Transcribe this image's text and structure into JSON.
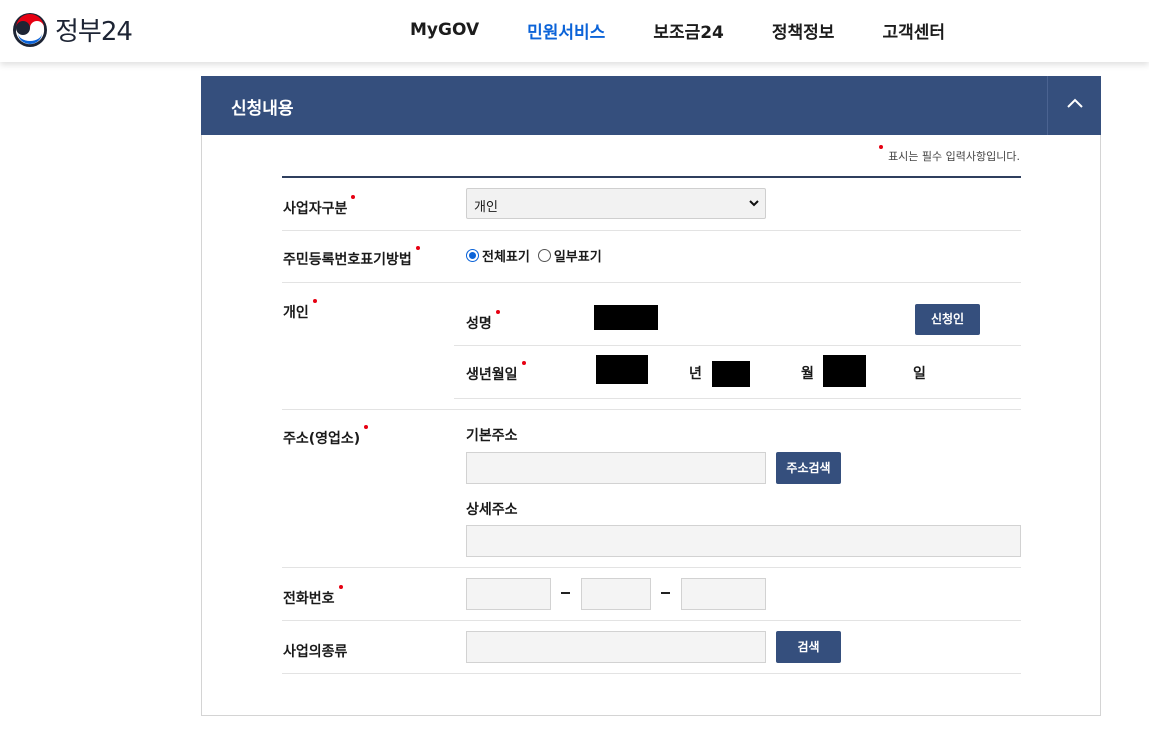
{
  "header": {
    "logo_text": "정부24",
    "nav": [
      "MyGOV",
      "민원서비스",
      "보조금24",
      "정책정보",
      "고객센터"
    ],
    "active_nav": "민원서비스"
  },
  "panel": {
    "title": "신청내용",
    "required_note": "표시는 필수 입력사항입니다."
  },
  "form": {
    "business_type": {
      "label": "사업자구분",
      "value": "개인"
    },
    "rrn_display": {
      "label": "주민등록번호표기방법",
      "options": [
        "전체표기",
        "일부표기"
      ],
      "selected": "전체표기"
    },
    "individual": {
      "label": "개인",
      "name_label": "성명",
      "applicant_button": "신청인",
      "birth_label": "생년월일",
      "year_unit": "년",
      "month_unit": "월",
      "day_unit": "일"
    },
    "address": {
      "label": "주소(영업소)",
      "basic_label": "기본주소",
      "search_button": "주소검색",
      "detail_label": "상세주소"
    },
    "phone": {
      "label": "전화번호",
      "separator": "-"
    },
    "business_kind": {
      "label": "사업의종류",
      "search_button": "검색"
    }
  },
  "colors": {
    "navy": "#354f7d",
    "active_blue": "#0b63d8",
    "required_red": "#e60012"
  }
}
